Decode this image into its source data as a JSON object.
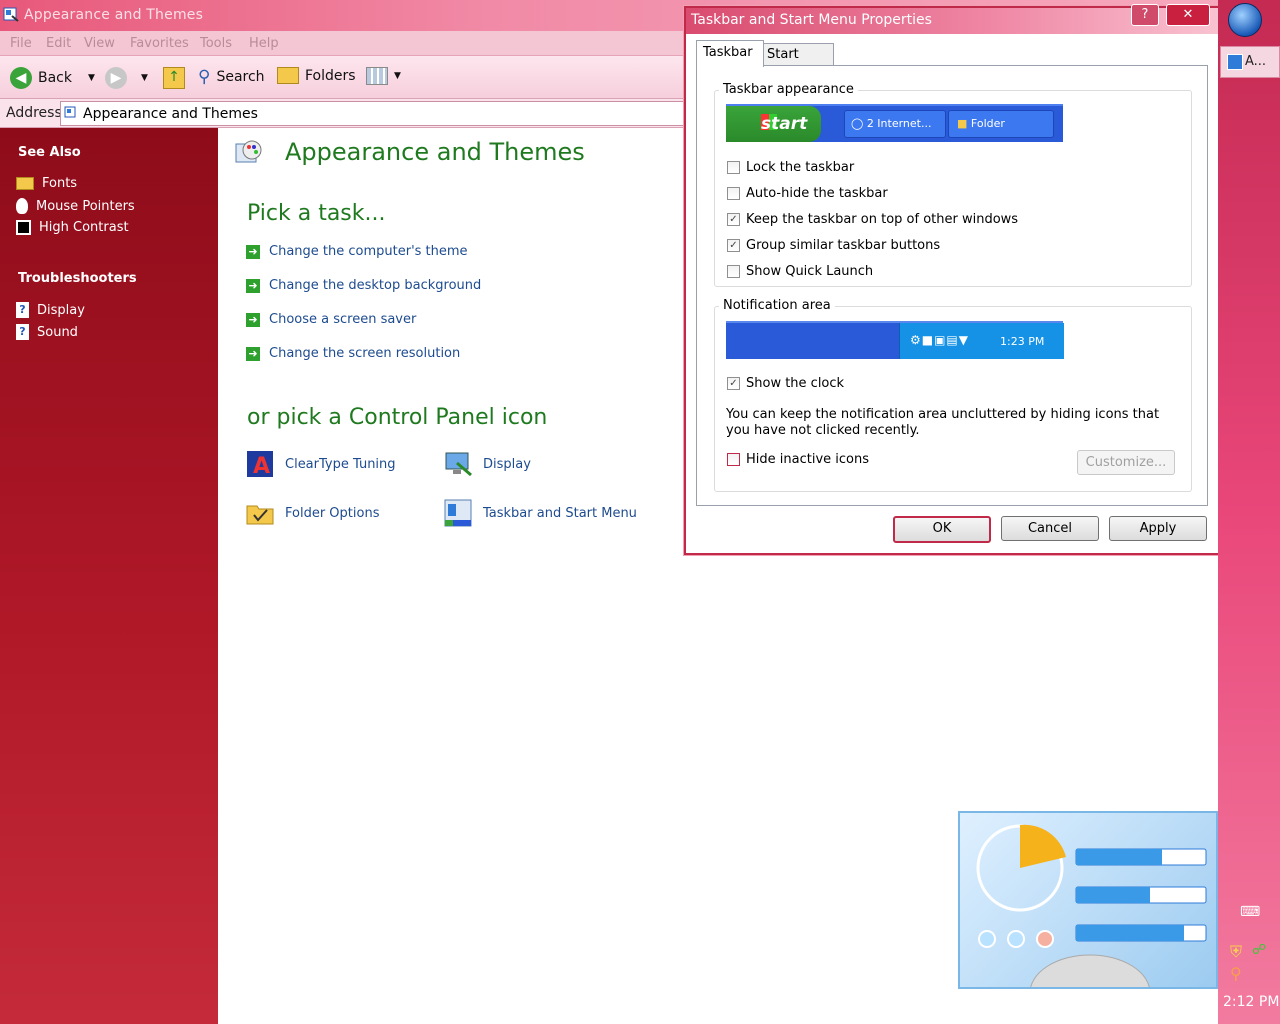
{
  "window": {
    "title": "Appearance and Themes",
    "menu": [
      "File",
      "Edit",
      "View",
      "Favorites",
      "Tools",
      "Help"
    ],
    "toolbar": {
      "back": "Back",
      "search": "Search",
      "folders": "Folders"
    },
    "address_label": "Address",
    "address_value": "Appearance and Themes"
  },
  "sidebar": {
    "see_also": "See Also",
    "see_also_items": [
      "Fonts",
      "Mouse Pointers",
      "High Contrast"
    ],
    "troubleshooters": "Troubleshooters",
    "troubleshooter_items": [
      "Display",
      "Sound"
    ]
  },
  "main": {
    "title": "Appearance and Themes",
    "pick_task": "Pick a task...",
    "tasks": [
      "Change the computer's theme",
      "Change the desktop background",
      "Choose a screen saver",
      "Change the screen resolution"
    ],
    "or_pick": "or pick a Control Panel icon",
    "icons": [
      "ClearType Tuning",
      "Display",
      "Folder Options",
      "Taskbar and Start Menu"
    ]
  },
  "dialog": {
    "title": "Taskbar and Start Menu Properties",
    "help_btn": "?",
    "close_btn": "✕",
    "tabs": [
      "Taskbar",
      "Start Menu"
    ],
    "taskbar_appearance": "Taskbar appearance",
    "preview": {
      "start": "start",
      "task1": "2 Internet...",
      "task2": "Folder"
    },
    "options": [
      {
        "label": "Lock the taskbar",
        "checked": false
      },
      {
        "label": "Auto-hide the taskbar",
        "checked": false
      },
      {
        "label": "Keep the taskbar on top of other windows",
        "checked": true
      },
      {
        "label": "Group similar taskbar buttons",
        "checked": true
      },
      {
        "label": "Show Quick Launch",
        "checked": false
      }
    ],
    "notification_area": "Notification area",
    "tray_time": "1:23 PM",
    "show_clock": {
      "label": "Show the clock",
      "checked": true
    },
    "note": "You can keep the notification area uncluttered by hiding icons that you have not clicked recently.",
    "hide_inactive": {
      "label": "Hide inactive icons",
      "checked": false
    },
    "customize": "Customize...",
    "ok": "OK",
    "cancel": "Cancel",
    "apply": "Apply"
  },
  "rightbar": {
    "task": "A...",
    "clock": "2:12 PM"
  }
}
